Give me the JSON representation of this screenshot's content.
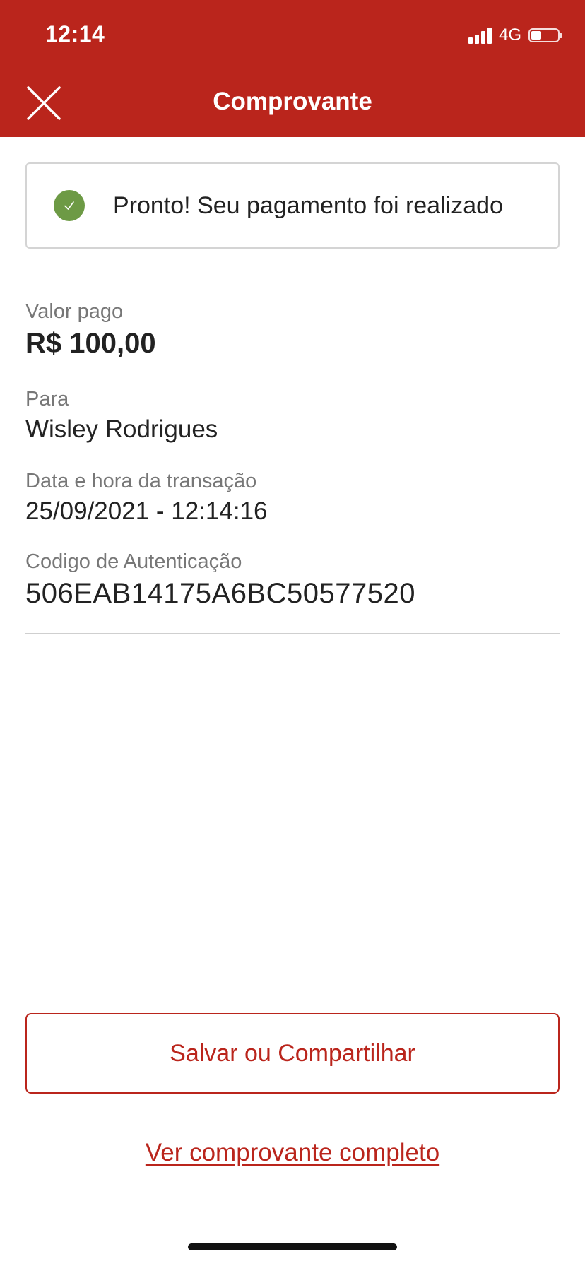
{
  "status_bar": {
    "time": "12:14",
    "network": "4G",
    "battery_level": 0.4,
    "signal_bars": 4
  },
  "header": {
    "title": "Comprovante",
    "close_icon": "close-icon",
    "background_color": "#ba251c"
  },
  "banner": {
    "icon": "check-circle-icon",
    "icon_color": "#6d9a45",
    "message": "Pronto! Seu pagamento foi realizado"
  },
  "details": {
    "amount": {
      "label": "Valor pago",
      "value": "R$ 100,00"
    },
    "recipient": {
      "label": "Para",
      "value": "Wisley Rodrigues"
    },
    "datetime": {
      "label": "Data e hora da transação",
      "value": "25/09/2021 - 12:14:16"
    },
    "auth_code": {
      "label": "Codigo de Autenticação",
      "value": "506EAB14175A6BC50577520"
    }
  },
  "actions": {
    "save_share_label": "Salvar ou Compartilhar",
    "full_receipt_link": "Ver comprovante completo",
    "accent_color": "#ba251c"
  }
}
